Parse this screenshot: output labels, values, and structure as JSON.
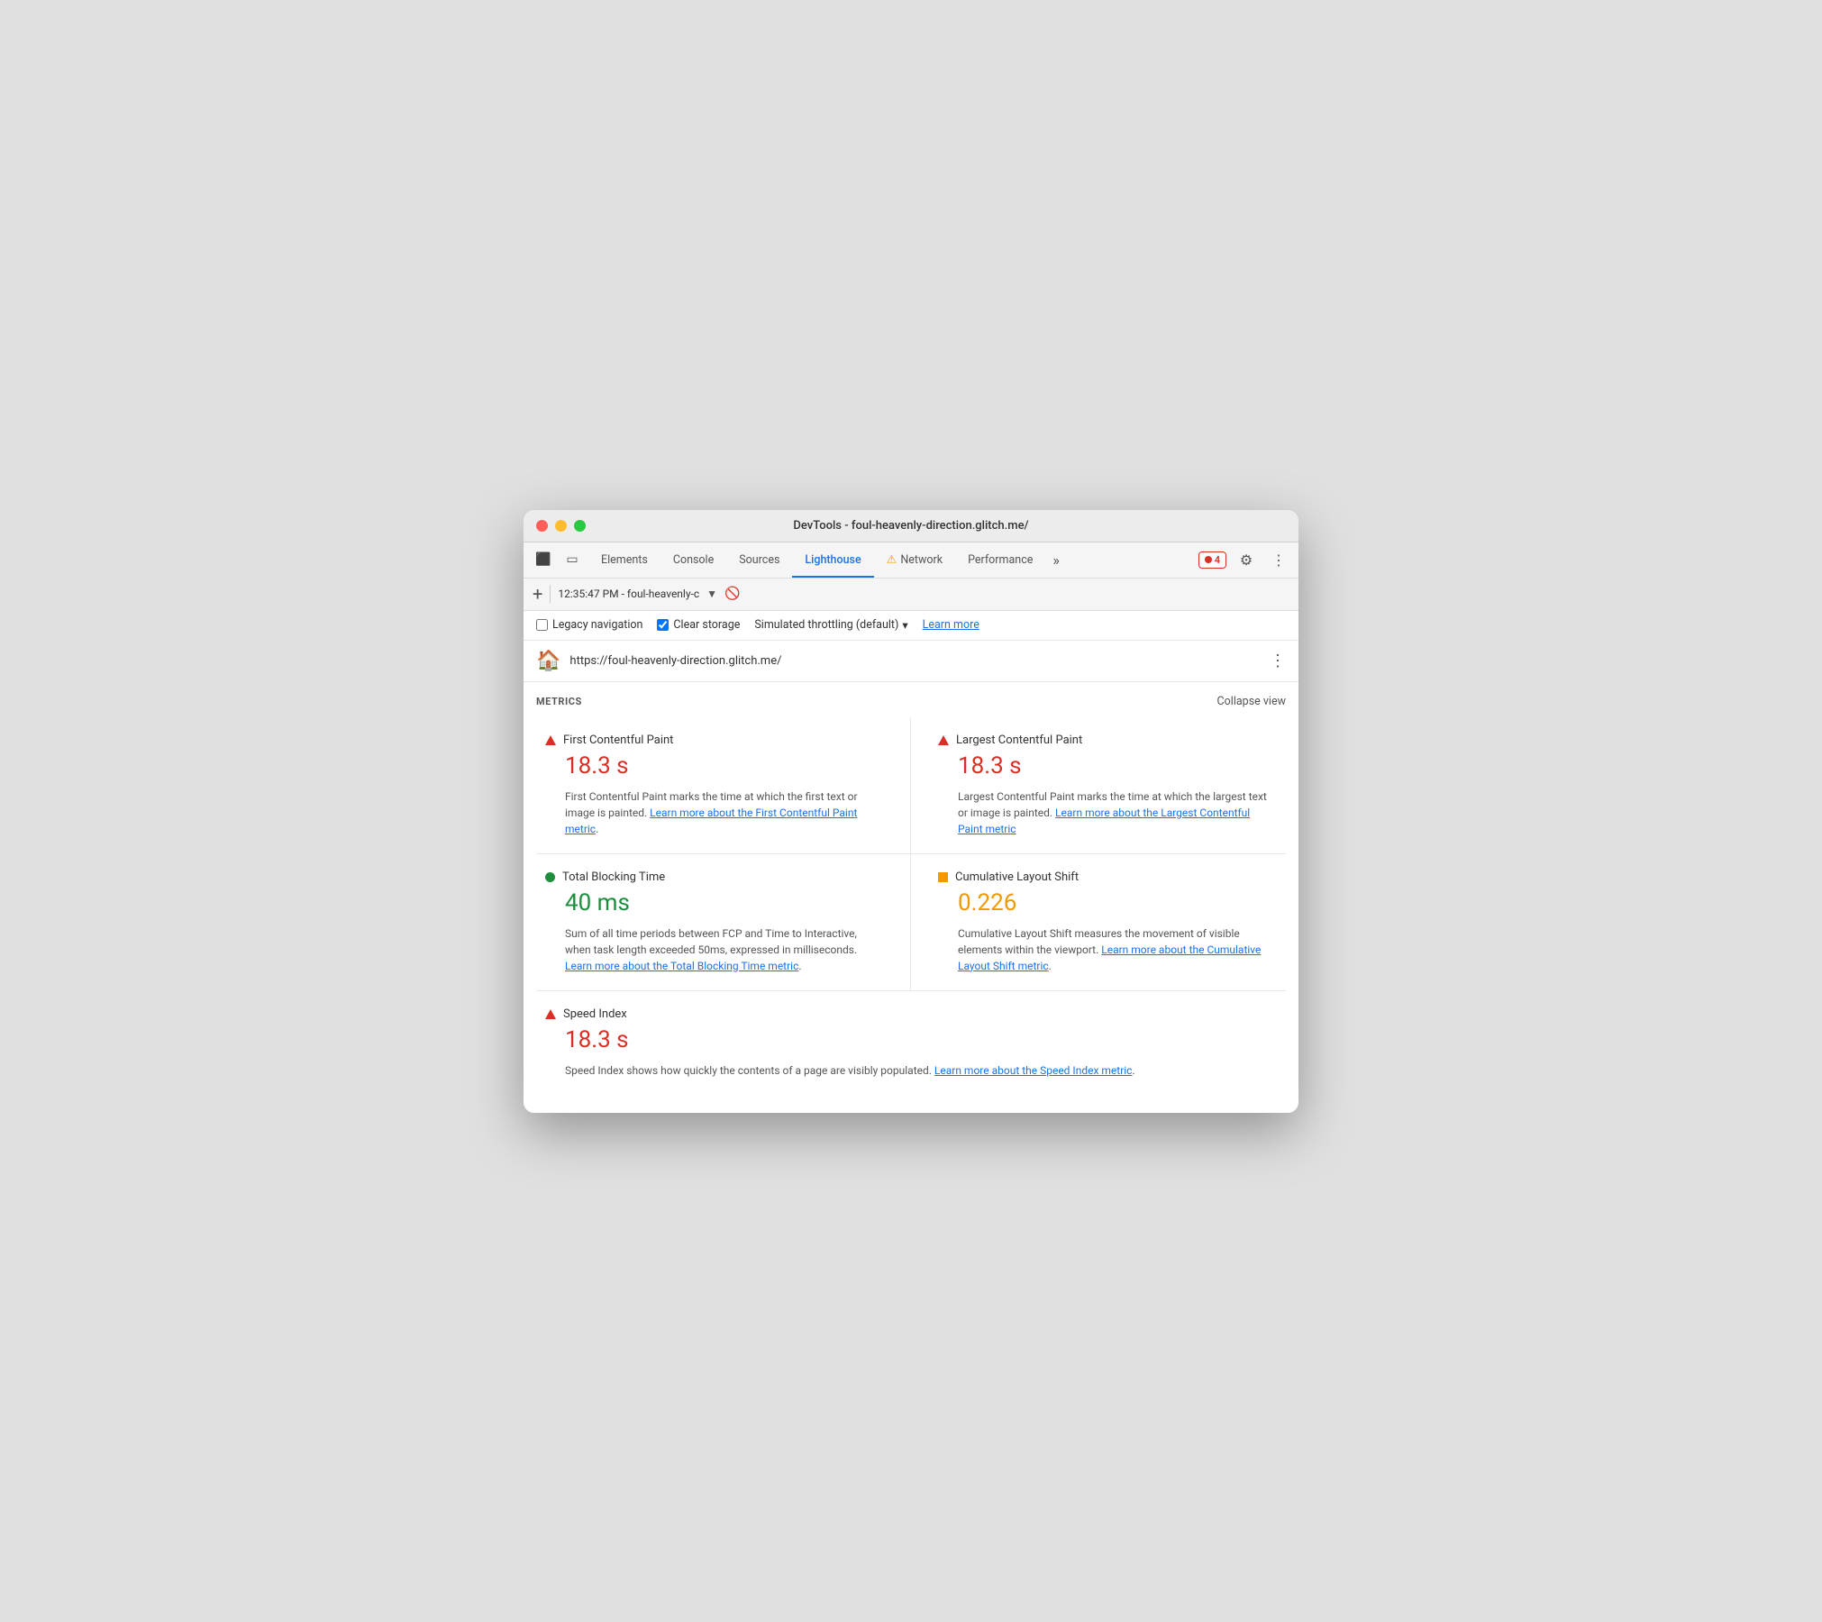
{
  "window": {
    "title": "DevTools - foul-heavenly-direction.glitch.me/"
  },
  "tabs": {
    "elements": "Elements",
    "console": "Console",
    "sources": "Sources",
    "lighthouse": "Lighthouse",
    "network": "Network",
    "performance": "Performance",
    "more": "»",
    "error_count": "4",
    "active": "lighthouse"
  },
  "address_bar": {
    "new_tab": "+",
    "timestamp": "12:35:47 PM - foul-heavenly-c",
    "arrow": "▼"
  },
  "options_bar": {
    "legacy_nav_label": "Legacy navigation",
    "clear_storage_label": "Clear storage",
    "throttle_label": "Simulated throttling (default)",
    "learn_more": "Learn more"
  },
  "url_bar": {
    "url": "https://foul-heavenly-direction.glitch.me/"
  },
  "metrics": {
    "section_title": "METRICS",
    "collapse_view": "Collapse view",
    "items": [
      {
        "id": "fcp",
        "name": "First Contentful Paint",
        "icon_type": "triangle",
        "color": "red",
        "value": "18.3 s",
        "description": "First Contentful Paint marks the time at which the first text or image is painted.",
        "link_text": "Learn more about the First Contentful Paint metric",
        "link_suffix": "."
      },
      {
        "id": "lcp",
        "name": "Largest Contentful Paint",
        "icon_type": "triangle",
        "color": "red",
        "value": "18.3 s",
        "description": "Largest Contentful Paint marks the time at which the largest text or image is painted.",
        "link_text": "Learn more about the Largest Contentful Paint metric",
        "link_suffix": ""
      },
      {
        "id": "tbt",
        "name": "Total Blocking Time",
        "icon_type": "circle",
        "color": "green",
        "value": "40 ms",
        "description": "Sum of all time periods between FCP and Time to Interactive, when task length exceeded 50ms, expressed in milliseconds.",
        "link_text": "Learn more about the Total Blocking Time metric",
        "link_suffix": "."
      },
      {
        "id": "cls",
        "name": "Cumulative Layout Shift",
        "icon_type": "square",
        "color": "orange",
        "value": "0.226",
        "description": "Cumulative Layout Shift measures the movement of visible elements within the viewport.",
        "link_text": "Learn more about the Cumulative Layout Shift metric",
        "link_suffix": "."
      },
      {
        "id": "si",
        "name": "Speed Index",
        "icon_type": "triangle",
        "color": "red",
        "value": "18.3 s",
        "description": "Speed Index shows how quickly the contents of a page are visibly populated.",
        "link_text": "Learn more about the Speed Index metric",
        "link_suffix": ".",
        "full_width": true
      }
    ]
  }
}
